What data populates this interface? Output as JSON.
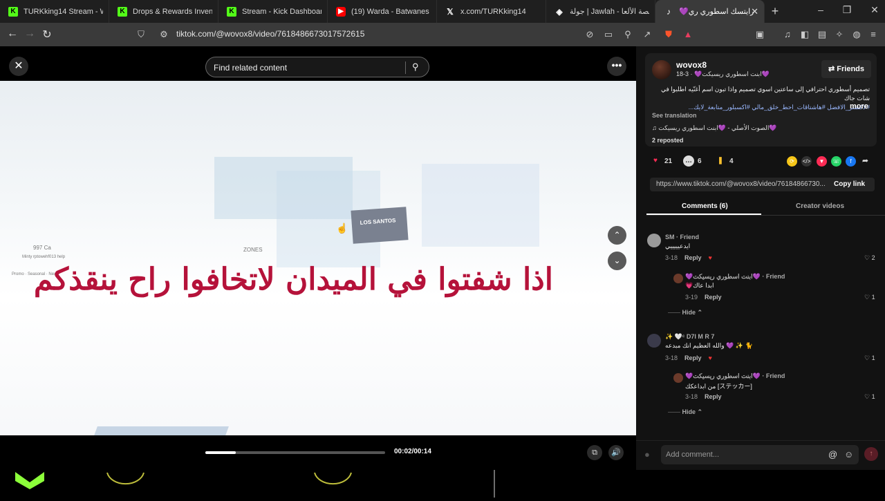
{
  "browser": {
    "tabs": [
      {
        "label": "TURKking14 Stream - Wat",
        "icon": "kick-icon"
      },
      {
        "label": "Drops & Rewards Inventor",
        "icon": "kick-icon"
      },
      {
        "label": "Stream - Kick Dashboard",
        "icon": "kick-icon"
      },
      {
        "label": "(19) Warda - Batwanes",
        "icon": "youtube-icon"
      },
      {
        "label": "x.com/TURKking14",
        "icon": "x-icon"
      },
      {
        "label": "جولة | Jawlah - منصة الألعا",
        "icon": "jawlah-icon"
      },
      {
        "label": "💜رايتسك اسطوري ري",
        "icon": "tiktok-icon",
        "active": true
      }
    ],
    "url": "tiktok.com/@wovox8/video/7618486673017572615"
  },
  "video": {
    "search_placeholder": "Find related content",
    "caption": "اذا شفتوا في الميدان لاتخافوا راح ينقذكم",
    "sign_text": "LOS SANTOS",
    "small_texts": [
      "997 Ca",
      "Minty rptowehf013 help",
      "Promo  ·  Seasonal  ·  Next",
      "ZONES"
    ],
    "time": "00:02/00:14",
    "progress": 0.17
  },
  "panel": {
    "username": "wovox8",
    "display_name": "💜ابنت اسطوري ريسيكت💜 · 3-18",
    "friends_label": "Friends",
    "description": "تصميم أسطوري احترافي إلى ساعتين اسوي تصميم واذا تبون اسم أغنّيه اطلبوا في شات جاك",
    "description_tags": "#لاكتشر_الافضل #هاشتاقات_احط_خلق_مالي #اكسبلور_متابعة_لايك...",
    "more_label": "more",
    "see_translation": "See translation",
    "sound": "♫ الصوت الأصلي - 💜ابنت اسطوري ريسيكت💜",
    "reposted": "2 reposted",
    "likes": "21",
    "comments_count": "6",
    "saves": "4",
    "link": "https://www.tiktok.com/@wovox8/video/76184866730...",
    "copy_link": "Copy link",
    "tab_comments": "Comments (6)",
    "tab_creator": "Creator videos",
    "comments": [
      {
        "name": "SM · Friend",
        "text": "ايدعيييييي",
        "date": "3-18",
        "reply": "Reply",
        "likes": "2"
      },
      {
        "name": "💜ابنت اسطوري ريسيكت💜 · Friend",
        "text": "💗ابدا عاك",
        "date": "3-19",
        "reply": "Reply",
        "likes": "1",
        "nested": true
      },
      {
        "name": "✨ 🤍ᶜ D7I M R 7",
        "text": "والله العظيم انك مبدعه 💜 ✨ 🐈",
        "date": "3-18",
        "reply": "Reply",
        "likes": "1"
      },
      {
        "name": "💜ابنت اسطوري ريسيكت💜 · Friend",
        "text": "من ابداعكك [ステッカー]",
        "date": "3-18",
        "reply": "Reply",
        "likes": "1",
        "nested": true
      }
    ],
    "hide_label": "Hide",
    "comment_placeholder": "Add comment..."
  }
}
